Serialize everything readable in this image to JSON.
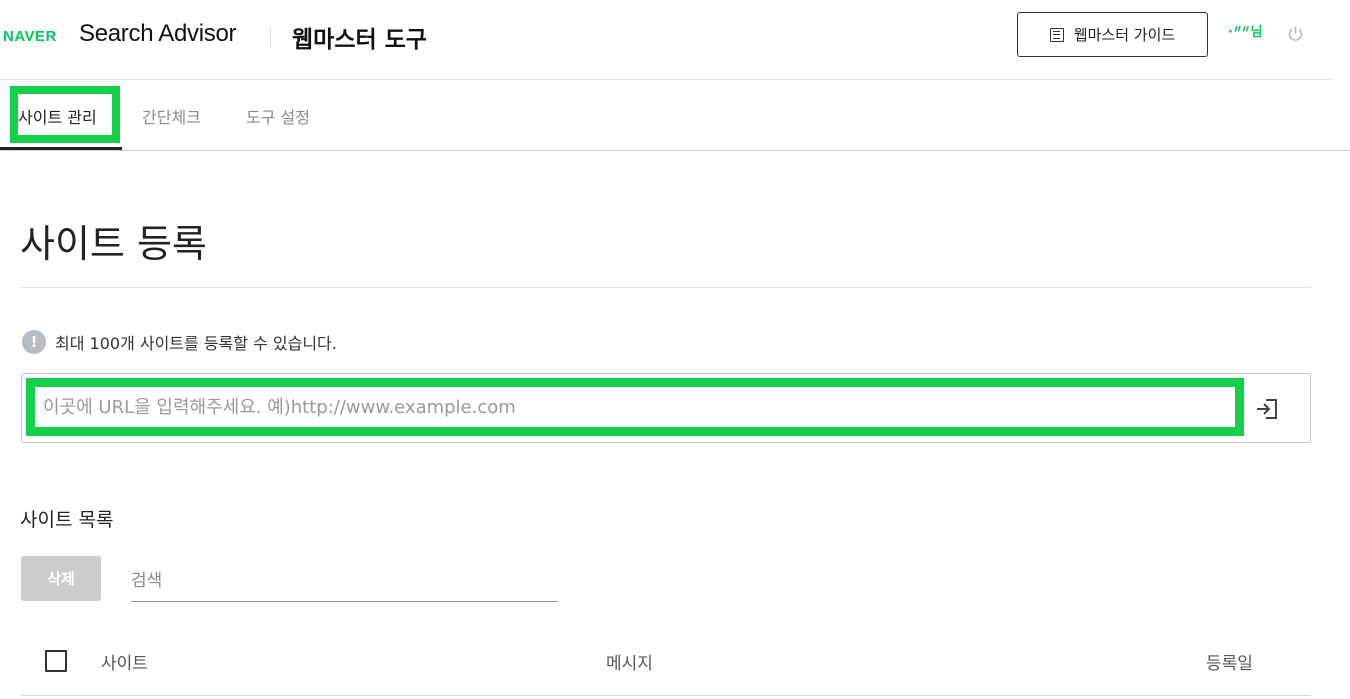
{
  "header": {
    "logo": "NAVER",
    "product": "Search Advisor",
    "tool_title": "웹마스터 도구",
    "guide_button": "웹마스터 가이드",
    "user_name": "·ᐥᐥ님",
    "icons": {
      "guide": "document-list-icon",
      "logout": "power-icon"
    }
  },
  "tabs": [
    {
      "label": "사이트 관리",
      "active": true
    },
    {
      "label": "간단체크",
      "active": false
    },
    {
      "label": "도구 설정",
      "active": false
    }
  ],
  "main": {
    "title": "사이트 등록",
    "notice": "최대 100개 사이트를 등록할 수 있습니다.",
    "notice_icon": "!",
    "url_input": {
      "value": "",
      "placeholder": "이곳에 URL을 입력해주세요. 예)http://www.example.com"
    },
    "submit_icon": "submit-arrow-icon"
  },
  "site_list": {
    "title": "사이트 목록",
    "delete_button": "삭제",
    "search": {
      "value": "",
      "placeholder": "검색"
    },
    "columns": [
      "사이트",
      "메시지",
      "등록일"
    ]
  },
  "colors": {
    "brand": "#03c75a",
    "highlight": "#14cf4c",
    "disabled": "#cccccc"
  }
}
